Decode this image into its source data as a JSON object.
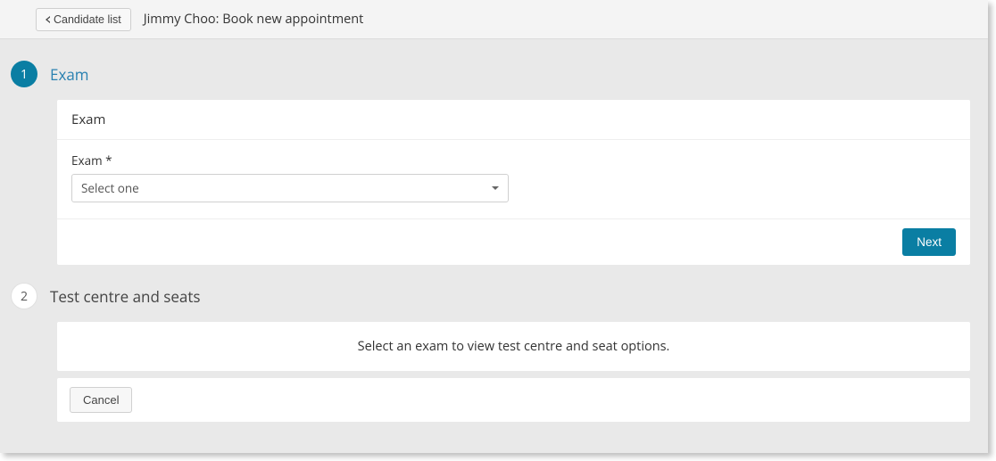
{
  "header": {
    "back_button_label": "Candidate list",
    "page_title": "Jimmy Choo: Book new appointment"
  },
  "step1": {
    "number": "1",
    "title": "Exam",
    "panel_header": "Exam",
    "field_label": "Exam *",
    "select_placeholder": "Select one",
    "next_button_label": "Next"
  },
  "step2": {
    "number": "2",
    "title": "Test centre and seats",
    "message": "Select an exam to view test centre and seat options.",
    "cancel_button_label": "Cancel"
  }
}
